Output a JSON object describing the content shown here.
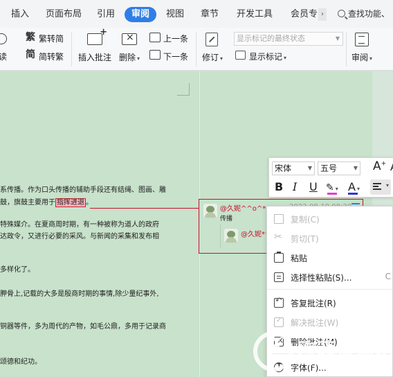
{
  "tabs": {
    "insert": "插入",
    "layout": "页面布局",
    "references": "引用",
    "review": "审阅",
    "view": "视图",
    "chapter": "章节",
    "developer": "开发工具",
    "member": "会员专",
    "more_arrow": "›",
    "search": "查找功能、"
  },
  "ribbon": {
    "read_label": "朗读",
    "trad_to_simp": "繁转简",
    "simp_to_trad": "简转繁",
    "insert_comment": "插入批注",
    "delete": "删除",
    "prev": "上一条",
    "next": "下一条",
    "track_changes": "修订",
    "markup_dropdown_value": "显示标记的最终状态",
    "show_markup": "显示标记",
    "review_pane": "审阅"
  },
  "document": {
    "paragraphs": [
      {
        "before": "系传播。作为口头传播的辅助手段还有结绳、图画、雕",
        "highlight": "",
        "after": ""
      },
      {
        "before": "鼓，旗鼓主要用于",
        "highlight": "指挥进退",
        "after": "。"
      },
      {
        "before": "特殊媒介。在夏商周时期，有一种被称为道人的政府",
        "highlight": "",
        "after": ""
      },
      {
        "before": "达政令，又进行必要的采风。与新闻的采集和发布相",
        "highlight": "",
        "after": ""
      },
      {
        "before": "多样化了。",
        "highlight": "",
        "after": ""
      },
      {
        "before": "胛骨上,记载的大多是殷商时期的事情,除少量纪事外,",
        "highlight": "",
        "after": ""
      },
      {
        "before": "铜器等件，多为周代的产物，如毛公鼎，多用于记录商",
        "highlight": "",
        "after": ""
      },
      {
        "before": "",
        "highlight": "",
        "after": ""
      },
      {
        "before": "颂德和纪功。",
        "highlight": "",
        "after": ""
      }
    ]
  },
  "comment": {
    "author": "@久妮^^o^*",
    "timestamp": "2022-08-19 08:20",
    "text": "传播",
    "reply_author": "@久妮*^"
  },
  "mini_toolbar": {
    "font_name": "宋体",
    "font_size": "五号",
    "grow_font": "A",
    "shrink_font": "A",
    "bold": "B",
    "italic": "I",
    "underline": "U",
    "font_color": "A",
    "highlight_color": "#e23ed1",
    "font_color_value": "#2f34d8"
  },
  "context_menu": {
    "copy": "复制(C)",
    "cut": "剪切(T)",
    "paste": "粘贴",
    "paste_special": "选择性粘贴(S)...",
    "paste_special_shortcut": "C",
    "reply_comment": "答复批注(R)",
    "resolve_comment": "解决批注(W)",
    "delete_comment": "删除批注(M)",
    "font": "字体(F)..."
  },
  "watermark": {
    "title": "欧菲资源网",
    "url": "www.office26.com"
  },
  "colors": {
    "accent": "#2f7ee6",
    "comment_red": "#c8102e",
    "page_bg": "#c8e2cb"
  }
}
